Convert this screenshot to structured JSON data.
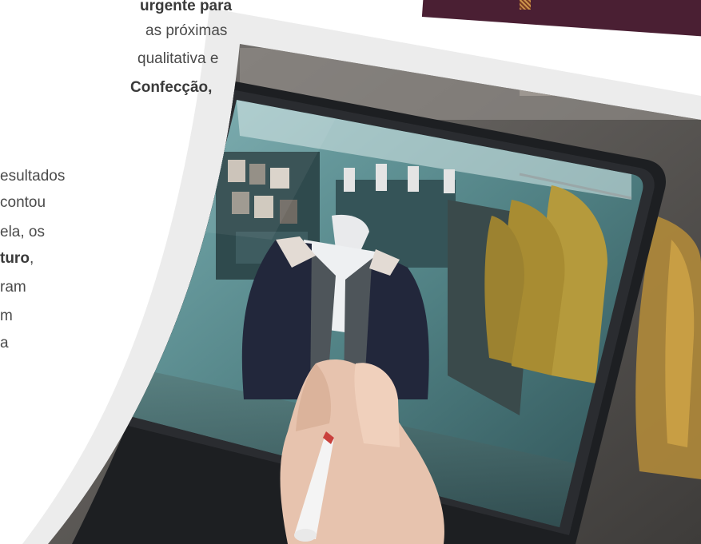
{
  "paragraph1": {
    "line1_bold": "urgente para",
    "line2": "as próximas",
    "line3": "qualitativa e",
    "line4_bold": "Confecção,"
  },
  "paragraph2": {
    "line1": "esultados",
    "line2": "contou",
    "line3": "ela, os",
    "line4_bold": "turo",
    "line4_tail": ",",
    "line5": "ram",
    "line6": "m",
    "line7": "a"
  },
  "photo": {
    "subject": "hand-with-stylus-on-tablet-showing-clothing-store-mannequin"
  },
  "colors": {
    "banner": "#4a1f33",
    "gray_band": "#ececec",
    "text": "#4a4a4a"
  }
}
